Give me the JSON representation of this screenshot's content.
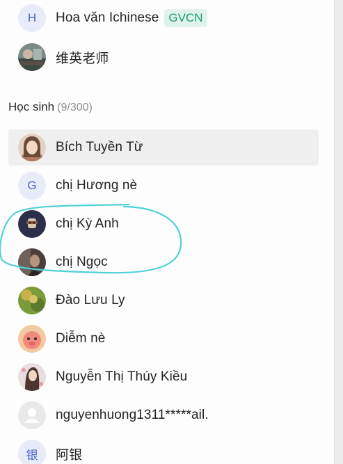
{
  "teachers": [
    {
      "avatar_letter": "H",
      "name": "Hoa văn Ichinese",
      "badge": "GVCN"
    },
    {
      "name": "维英老师"
    }
  ],
  "students_section": {
    "title": "Học sinh",
    "count": "(9/300)"
  },
  "students": [
    {
      "name": "Bích Tuyền Từ"
    },
    {
      "avatar_letter": "G",
      "name": "chị Hương nè"
    },
    {
      "name": "chị Kỳ Anh"
    },
    {
      "name": "chị Ngọc"
    },
    {
      "name": "Đào Lưu Ly"
    },
    {
      "name": "Diễm nè"
    },
    {
      "name": "Nguyễn Thị Thúy Kiều"
    },
    {
      "name": "nguyenhuong1311*****ail."
    },
    {
      "avatar_letter": "银",
      "name": "阿银"
    }
  ],
  "colors": {
    "badge_bg": "#dff3ec",
    "badge_text": "#1e9b6d",
    "letter_avatar_bg": "#e8ebf8",
    "letter_avatar_text": "#4a64c9",
    "selected_row_bg": "#efefef",
    "annotation_stroke": "#4fd1d6"
  },
  "icons": {
    "default_avatar": "person-icon"
  }
}
